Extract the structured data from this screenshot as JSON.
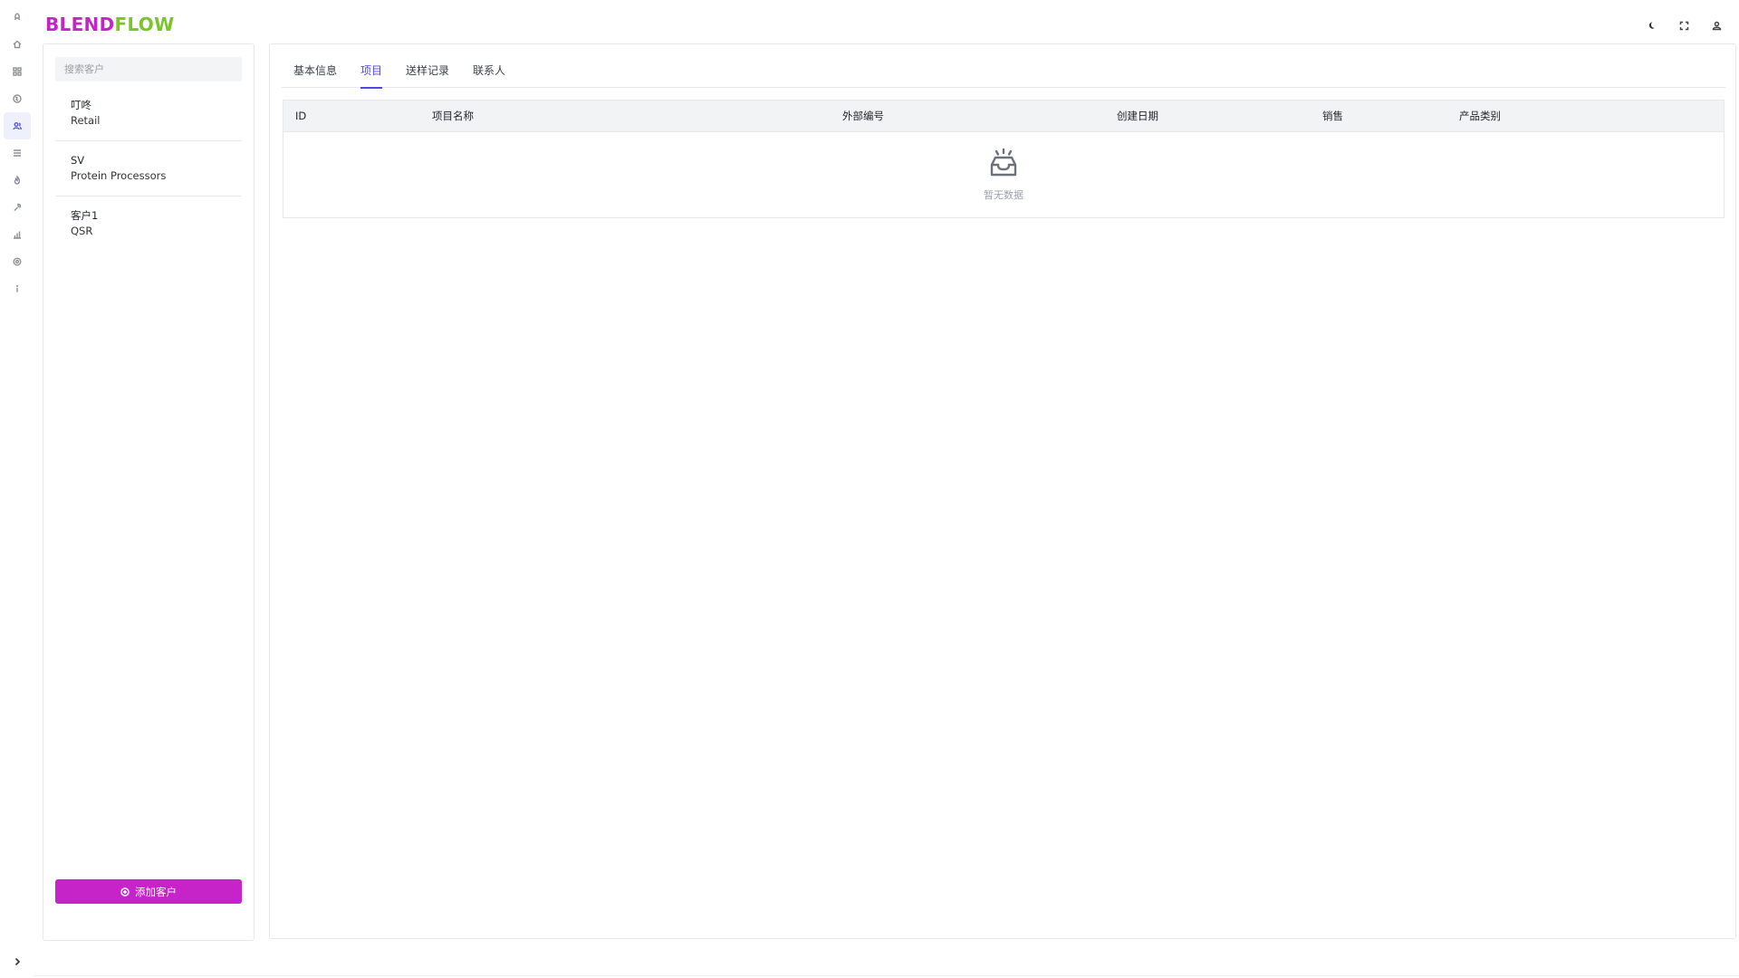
{
  "app": {
    "logo_part1": "BLEND",
    "logo_part2": "FLOW"
  },
  "rail": {
    "items": [
      {
        "icon": "rocket-icon",
        "active": false
      },
      {
        "icon": "home-icon",
        "active": false
      },
      {
        "icon": "grid-icon",
        "active": false
      },
      {
        "icon": "globe-icon",
        "active": false
      },
      {
        "icon": "customers-icon",
        "active": true
      },
      {
        "icon": "list-icon",
        "active": false
      },
      {
        "icon": "flame-icon",
        "active": false
      },
      {
        "icon": "wrench-icon",
        "active": false
      },
      {
        "icon": "bar-chart-icon",
        "active": false
      },
      {
        "icon": "settings-icon",
        "active": false
      },
      {
        "icon": "info-icon",
        "active": false
      }
    ],
    "expand_icon": "chevron-right-icon"
  },
  "header": {
    "buttons": [
      "moon-icon",
      "fullscreen-icon",
      "user-icon"
    ]
  },
  "customers": {
    "search_placeholder": "搜索客户",
    "items": [
      {
        "name": "叮咚",
        "type": "Retail"
      },
      {
        "name": "SV",
        "type": "Protein Processors"
      },
      {
        "name": "客户1",
        "type": "QSR"
      }
    ],
    "add_label": "添加客户"
  },
  "main": {
    "tabs": [
      {
        "label": "基本信息",
        "active": false
      },
      {
        "label": "项目",
        "active": true
      },
      {
        "label": "送样记录",
        "active": false
      },
      {
        "label": "联系人",
        "active": false
      }
    ],
    "table": {
      "columns": [
        "ID",
        "项目名称",
        "外部编号",
        "创建日期",
        "销售",
        "产品类别"
      ],
      "rows": [],
      "empty_text": "暂无数据"
    }
  },
  "colors": {
    "brand_magenta": "#c624c9",
    "brand_green": "#7cc42b",
    "accent": "#4f46e5"
  }
}
